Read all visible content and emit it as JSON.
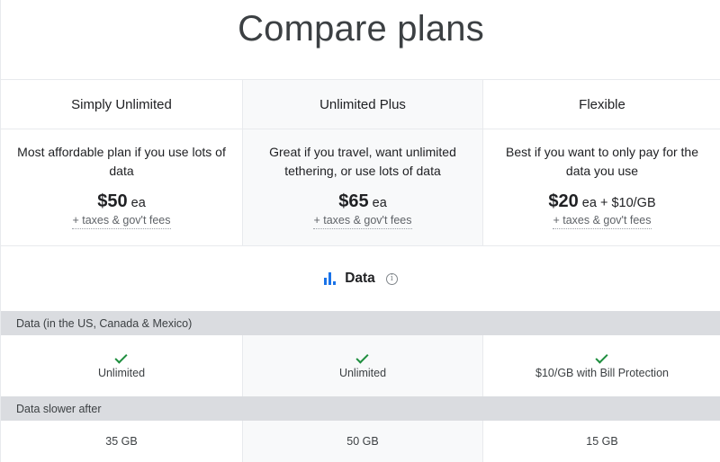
{
  "header": {
    "title": "Compare plans"
  },
  "plans": [
    {
      "name": "Simply Unlimited",
      "description": "Most affordable plan if you use lots of data",
      "price": "$50",
      "price_unit": "ea",
      "price_extra": "",
      "fees": "+ taxes & gov't fees"
    },
    {
      "name": "Unlimited Plus",
      "description": "Great if you travel, want unlimited tethering, or use lots of data",
      "price": "$65",
      "price_unit": "ea",
      "price_extra": "",
      "fees": "+ taxes & gov't fees"
    },
    {
      "name": "Flexible",
      "description": "Best if you want to only pay for the data you use",
      "price": "$20",
      "price_unit": "ea",
      "price_extra": "+ $10/GB",
      "fees": "+ taxes & gov't fees"
    }
  ],
  "section": {
    "label": "Data",
    "icon": "bar-chart-icon",
    "info_icon": "info-icon"
  },
  "features": [
    {
      "label": "Data (in the US, Canada & Mexico)",
      "values": [
        "Unlimited",
        "Unlimited",
        "$10/GB with Bill Protection"
      ],
      "checks": [
        true,
        true,
        true
      ]
    },
    {
      "label": "Data slower after",
      "values": [
        "35 GB",
        "50 GB",
        "15 GB"
      ]
    }
  ],
  "colors": {
    "accent": "#1a73e8",
    "check": "#1e8e3e",
    "band": "#dadce0",
    "highlight_col": "#f8f9fa"
  }
}
